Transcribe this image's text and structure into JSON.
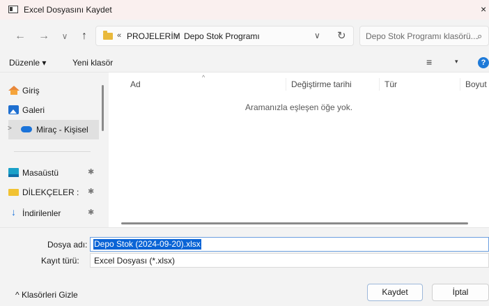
{
  "window": {
    "title": "Excel Dosyasını Kaydet",
    "close_glyph": "×"
  },
  "nav": {
    "back_glyph": "←",
    "forward_glyph": "→",
    "recent_glyph": "∨",
    "up_glyph": "↑",
    "breadcrumb_overflow": "«",
    "breadcrumb": [
      "PROJELERİM",
      "Depo Stok Programı"
    ],
    "breadcrumb_sep": "›",
    "address_dropdown_glyph": "∨",
    "refresh_glyph": "↻",
    "search_placeholder": "Depo Stok Programı klasörü...",
    "search_glyph": "⌕"
  },
  "toolbar": {
    "organize_label": "Düzenle ▾",
    "new_folder_label": "Yeni klasör",
    "view_glyph": "≡",
    "view_dropdown_glyph": "▾",
    "help_glyph": "?"
  },
  "sidebar": {
    "items": [
      {
        "label": "Giriş",
        "icon": "home-icon"
      },
      {
        "label": "Galeri",
        "icon": "gallery-icon"
      },
      {
        "label": "Miraç - Kişisel",
        "icon": "onedrive-cloud-icon",
        "expand_glyph": ">",
        "selected": true
      },
      {
        "label": "Masaüstü",
        "icon": "desktop-icon",
        "pinned": true
      },
      {
        "label": "DİLEKÇELER :",
        "icon": "folder-icon",
        "pinned": true
      },
      {
        "label": "İndirilenler",
        "icon": "download-icon",
        "pinned": true
      }
    ],
    "pin_glyph": "✱",
    "download_glyph": "↓"
  },
  "file_list": {
    "columns": [
      "Ad",
      "Değiştirme tarihi",
      "Tür",
      "Boyut"
    ],
    "sort_glyph": "^",
    "empty_message": "Aramanızla eşleşen öğe yok."
  },
  "form": {
    "filename_label": "Dosya adı:",
    "filename_value": "Depo Stok (2024-09-20).xlsx",
    "filetype_label": "Kayıt türü:",
    "filetype_value": "Excel Dosyası (*.xlsx)"
  },
  "footer": {
    "hide_folders_label": "^  Klasörleri Gizle",
    "save_label": "Kaydet",
    "cancel_label": "İptal"
  }
}
